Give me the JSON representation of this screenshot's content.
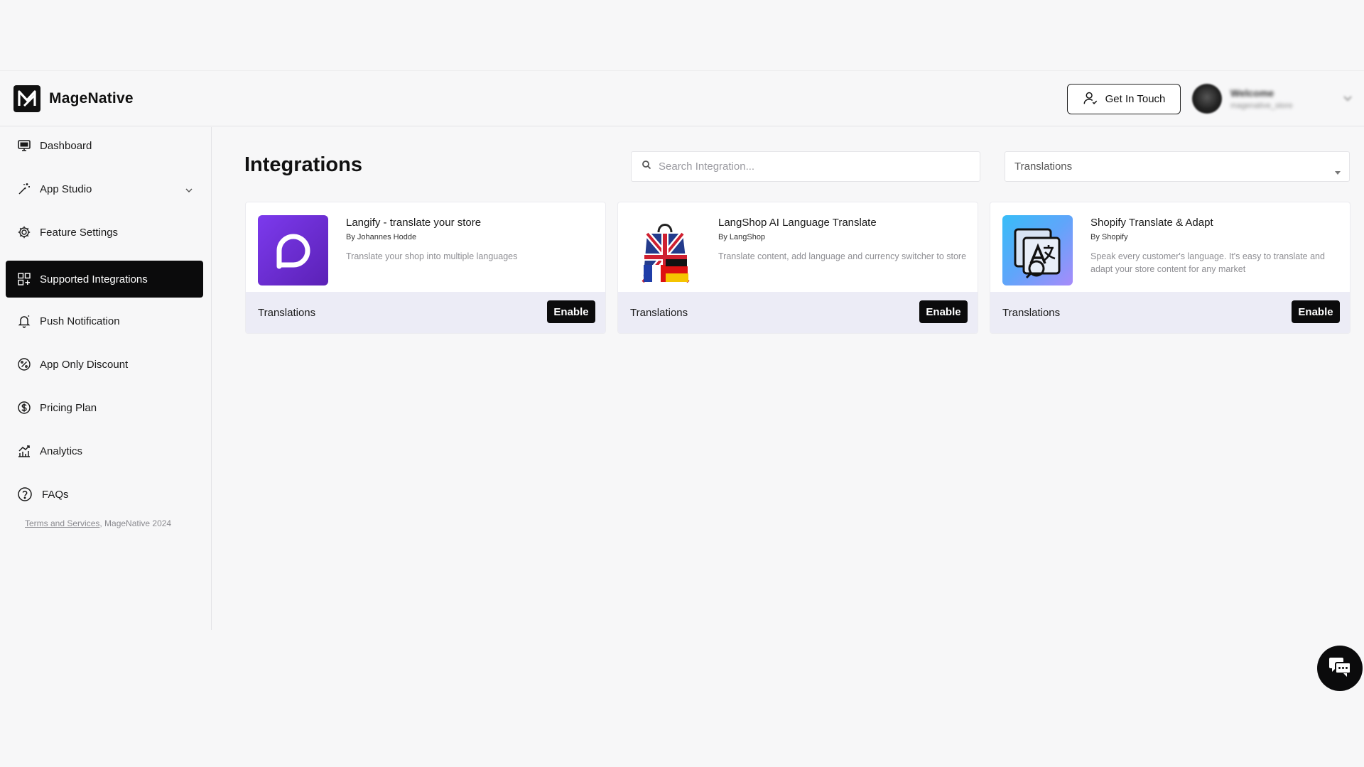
{
  "brand": {
    "name": "MageNative"
  },
  "header": {
    "get_in_touch_label": "Get In Touch",
    "user": {
      "greeting": "Welcome",
      "store": "magenative_store"
    }
  },
  "sidebar": {
    "items": [
      {
        "label": "Dashboard",
        "icon": "monitor-icon"
      },
      {
        "label": "App Studio",
        "icon": "magic-wand-icon"
      },
      {
        "label": "Feature Settings",
        "icon": "gear-icon"
      },
      {
        "label": "Supported Integrations",
        "icon": "apps-grid-icon"
      },
      {
        "label": "Push Notification",
        "icon": "bell-icon"
      },
      {
        "label": "App Only Discount",
        "icon": "percent-icon"
      },
      {
        "label": "Pricing Plan",
        "icon": "dollar-circle-icon"
      },
      {
        "label": "Analytics",
        "icon": "chart-icon"
      },
      {
        "label": "FAQs",
        "icon": "question-circle-icon"
      }
    ],
    "active_item": "Supported Integrations",
    "footer_link": "Terms and Services",
    "footer_text": ", MageNative 2024"
  },
  "main": {
    "title": "Integrations",
    "search": {
      "placeholder": "Search Integration...",
      "value": ""
    },
    "category_select": {
      "value": "Translations"
    },
    "cards": [
      {
        "name": "Langify - translate your store",
        "by": "By Johannes Hodde",
        "description": "Translate your shop into multiple languages",
        "category": "Translations",
        "button": "Enable",
        "logo": "langify-logo"
      },
      {
        "name": "LangShop AI Language Translate",
        "by": "By LangShop",
        "description": "Translate content, add language and currency switcher to store",
        "category": "Translations",
        "button": "Enable",
        "logo": "langshop-bag-logo"
      },
      {
        "name": "Shopify Translate & Adapt",
        "by": "By Shopify",
        "description": "Speak every customer's language. It's easy to translate and adapt your store content for any market",
        "category": "Translations",
        "button": "Enable",
        "logo": "shopify-translate-logo"
      }
    ]
  },
  "colors": {
    "accent": "#0b0b0c",
    "background": "#f7f7f8",
    "card_footer": "#ececf6",
    "langify_purple": "#6d28d9",
    "shopify_translate_blue": "#60a5fa"
  }
}
